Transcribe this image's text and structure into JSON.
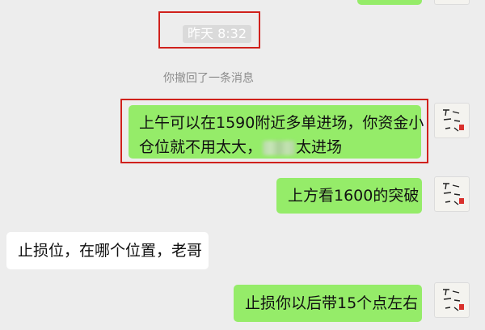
{
  "timestamp": "昨天 8:32",
  "system_note": "你撤回了一条消息",
  "messages": [
    {
      "line1": "上午可以在1590附近多单进场，你资金小",
      "line2_before": "仓位就不用太大，",
      "line2_after": "太进场",
      "side": "out"
    },
    {
      "text": "上方看1600的突破",
      "side": "out"
    },
    {
      "text": "止损位，在哪个位置，老哥",
      "side": "in"
    },
    {
      "text": "止损你以后带15个点左右",
      "side": "out"
    }
  ],
  "avatar_icon": "calligraphy-seal-avatar-icon",
  "colors": {
    "background": "#ededed",
    "outgoing_bubble": "#95ec69",
    "incoming_bubble": "#ffffff",
    "highlight_border": "#d0211c",
    "seal": "#d9302c"
  }
}
